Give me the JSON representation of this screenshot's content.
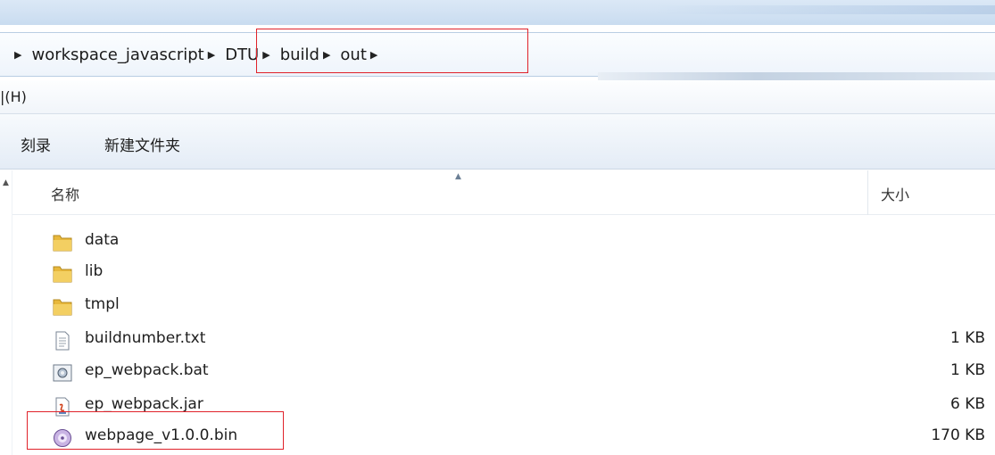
{
  "breadcrumb": {
    "items": [
      "workspace_javascript",
      "DTU",
      "build",
      "out"
    ]
  },
  "menubar": {
    "help_label": "|(H)"
  },
  "toolbar": {
    "burn_label": "刻录",
    "new_folder_label": "新建文件夹"
  },
  "columns": {
    "name": "名称",
    "size": "大小"
  },
  "files": [
    {
      "name": "data",
      "size": "",
      "icon": "folder-icon"
    },
    {
      "name": "lib",
      "size": "",
      "icon": "folder-icon"
    },
    {
      "name": "tmpl",
      "size": "",
      "icon": "folder-icon"
    },
    {
      "name": "buildnumber.txt",
      "size": "1 KB",
      "icon": "text-file-icon"
    },
    {
      "name": "ep_webpack.bat",
      "size": "1 KB",
      "icon": "batch-file-icon"
    },
    {
      "name": "ep_webpack.jar",
      "size": "6 KB",
      "icon": "jar-file-icon"
    },
    {
      "name": "webpage_v1.0.0.bin",
      "size": "170 KB",
      "icon": "bin-file-icon"
    }
  ],
  "colors": {
    "highlight_box": "#e0222a",
    "folder": "#e8b83c"
  }
}
